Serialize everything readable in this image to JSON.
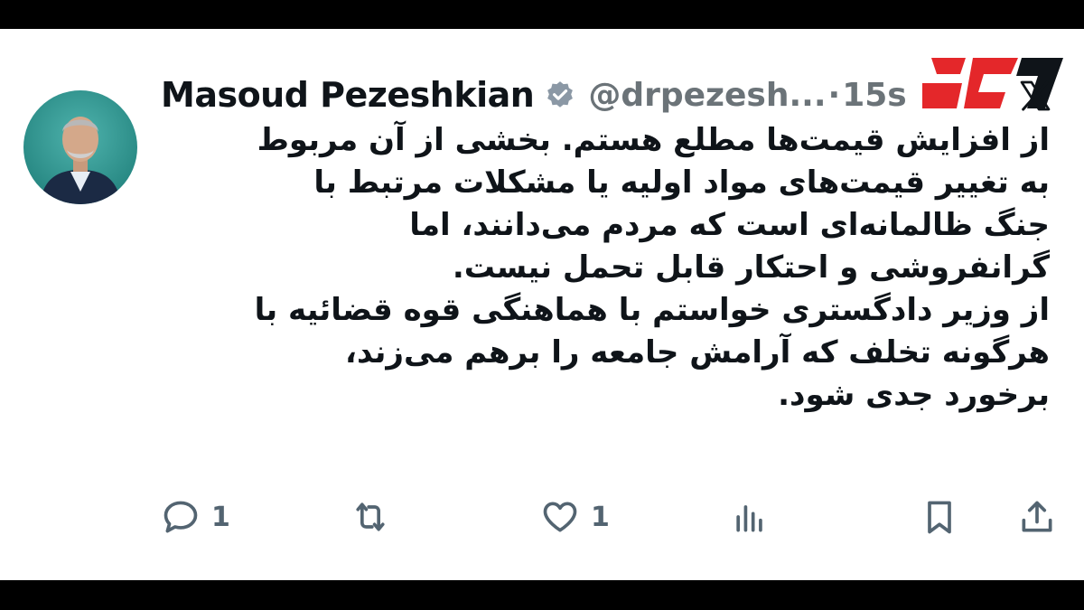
{
  "tweet": {
    "author_name": "Masoud Pezeshkian",
    "handle": "@drpezesh...",
    "separator": "·",
    "time": "15s",
    "verified": true,
    "text_lines": [
      "از افزایش قیمت‌ها مطلع هستم. بخشی از آن مربوط",
      "به تغییر قیمت‌های مواد اولیه یا مشکلات مرتبط با",
      "جنگ ظالمانه‌ای است که مردم می‌دانند، اما",
      "گرانفروشی و احتکار قابل تحمل نیست.",
      "از وزیر دادگستری خواستم با هماهنگی قوه قضائیه با",
      "هرگونه تخلف که آرامش جامعه را برهم می‌زند،",
      "برخورد جدی شود."
    ]
  },
  "actions": {
    "reply_count": "1",
    "retweet_count": "",
    "like_count": "1"
  },
  "icons": {
    "verified": "verified-badge-icon",
    "platform": "x-logo-icon",
    "reply": "reply-icon",
    "retweet": "retweet-icon",
    "like": "heart-icon",
    "views": "views-icon",
    "bookmark": "bookmark-icon",
    "share": "share-icon"
  },
  "colors": {
    "text": "#0f1419",
    "muted": "#536471",
    "background": "#ffffff",
    "frame": "#000000",
    "logo_red": "#e4272a"
  }
}
